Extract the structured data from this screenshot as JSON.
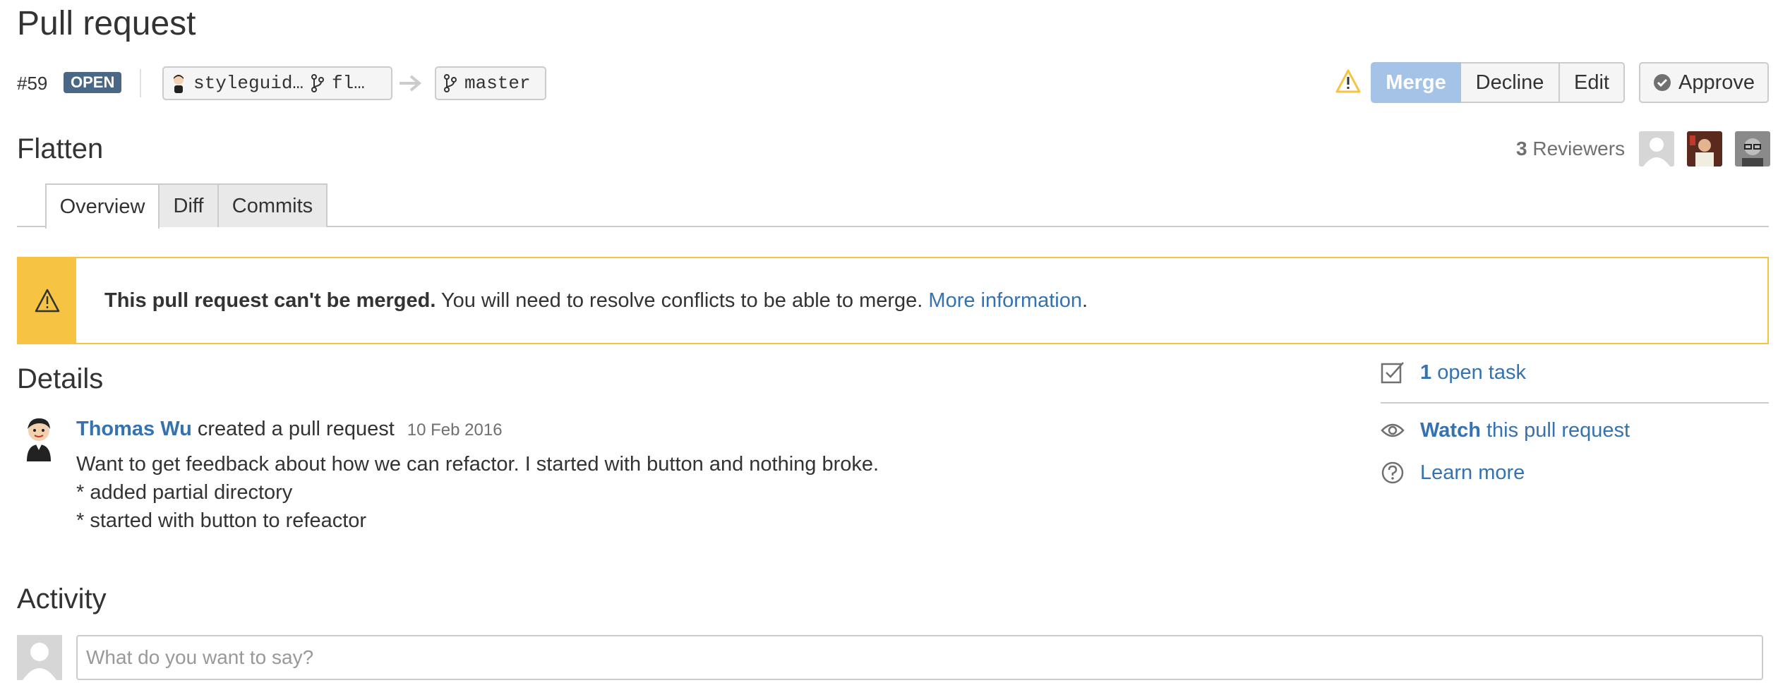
{
  "page": {
    "title": "Pull request",
    "pr_number": "#59",
    "status": "OPEN",
    "source_branch": "styleguid…",
    "source_branch_short": "fl…",
    "target_branch": "master",
    "subtitle": "Flatten"
  },
  "actions": {
    "merge": "Merge",
    "decline": "Decline",
    "edit": "Edit",
    "approve": "Approve"
  },
  "reviewers": {
    "count": "3",
    "label": "Reviewers"
  },
  "tabs": [
    {
      "label": "Overview"
    },
    {
      "label": "Diff"
    },
    {
      "label": "Commits"
    }
  ],
  "alert": {
    "bold": "This pull request can't be merged.",
    "text": " You will need to resolve conflicts to be able to merge. ",
    "link": "More information",
    "end": "."
  },
  "details": {
    "heading": "Details",
    "author": "Thomas Wu",
    "action": " created a pull request",
    "date": "10 Feb 2016",
    "description": [
      "Want to get feedback about how we can refactor. I started with button and nothing broke.",
      "* added partial directory",
      "* started with button to refeactor"
    ]
  },
  "sidebar": {
    "tasks_count": "1",
    "tasks_label": " open task",
    "watch_bold": "Watch",
    "watch_rest": " this pull request",
    "learn_more": "Learn more"
  },
  "activity": {
    "heading": "Activity",
    "placeholder": "What do you want to say?"
  },
  "colors": {
    "link": "#3572b0",
    "warning": "#f6c342",
    "open_badge": "#4a6785",
    "merge_disabled": "#a5c3e6"
  }
}
